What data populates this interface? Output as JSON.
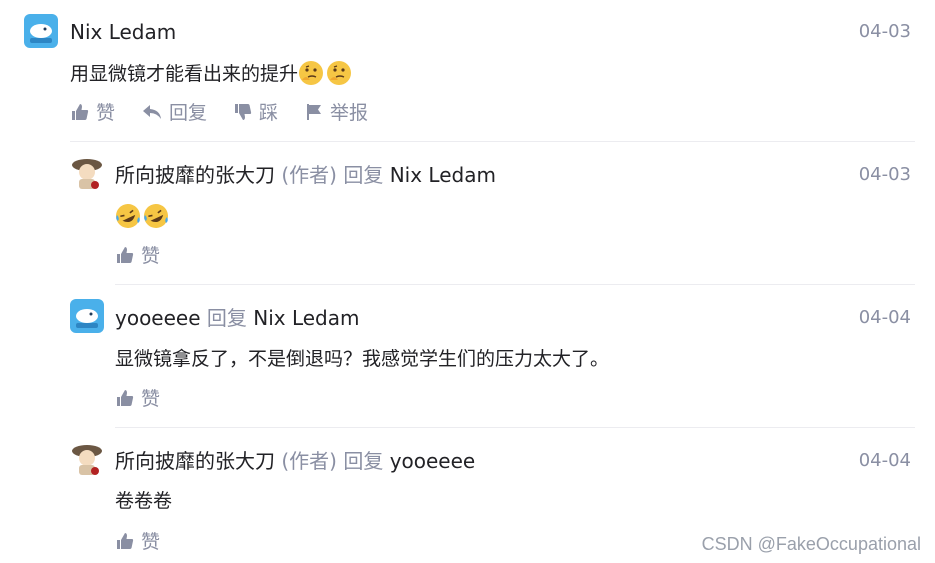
{
  "comments": [
    {
      "user": "Nix Ledam",
      "date": "04-03",
      "text": "用显微镜才能看出来的提升",
      "emojis": [
        "thinking-face",
        "thinking-face"
      ],
      "actions": [
        "赞",
        "回复",
        "踩",
        "举报"
      ]
    },
    {
      "user": "所向披靡的张大刀",
      "tag": "(作者)",
      "reply_word": "回复",
      "reply_to": "Nix Ledam",
      "date": "04-03",
      "text": "",
      "emojis": [
        "rolling-laughing",
        "rolling-laughing"
      ],
      "actions": [
        "赞"
      ]
    },
    {
      "user": "yooeeee",
      "reply_word": "回复",
      "reply_to": "Nix Ledam",
      "date": "04-04",
      "text": "显微镜拿反了，不是倒退吗？我感觉学生们的压力太大了。",
      "actions": [
        "赞"
      ]
    },
    {
      "user": "所向披靡的张大刀",
      "tag": "(作者)",
      "reply_word": "回复",
      "reply_to": "yooeeee",
      "date": "04-04",
      "text": "卷卷卷",
      "actions": [
        "赞"
      ]
    }
  ],
  "watermark": "CSDN @FakeOccupational",
  "colors": {
    "muted": "#8a8fa3",
    "text": "#222226",
    "avatar_blue": "#4ab0ea"
  }
}
